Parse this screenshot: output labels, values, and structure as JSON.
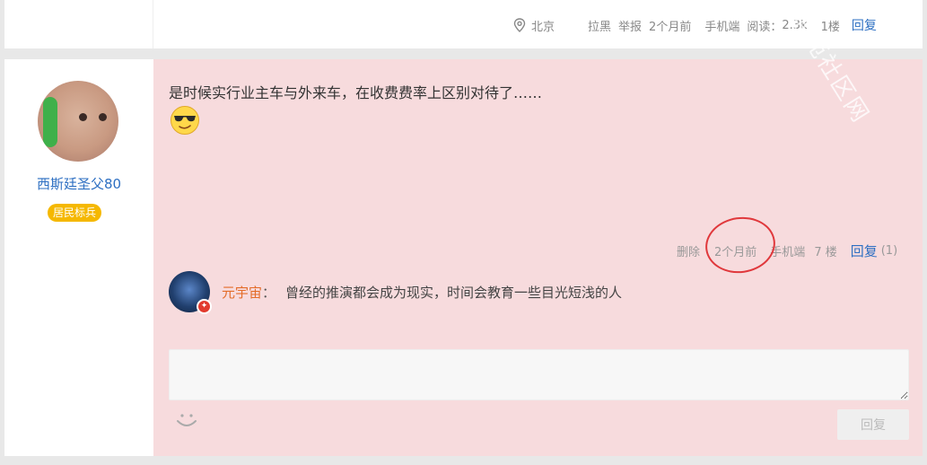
{
  "top_post": {
    "location": "北京",
    "actions": [
      "拉黑",
      "举报"
    ],
    "time": "2个月前",
    "device": "手机端",
    "reads_label": "阅读：",
    "reads_value": "2.3k",
    "floor": "1楼",
    "reply_label": "回复"
  },
  "post": {
    "author_name": "西斯廷圣父80",
    "author_rank": "居民标兵",
    "content": "是时候实行业主车与外来车，在收费费率上区别对待了……",
    "meta": {
      "delete_label": "删除",
      "time": "2个月前",
      "device": "手机端",
      "floor": "7 楼",
      "reply_label": "回复",
      "reply_count": "(1)"
    },
    "reply": {
      "name": "元宇宙",
      "colon": "：",
      "text": "曾经的推演都会成为现实，时间会教育一些目光短浅的人"
    },
    "submit_label": "回复",
    "reply_box_placeholder": ""
  },
  "watermark": "通苑社区网",
  "colors": {
    "accent_blue": "#2d6fc2",
    "post_bg": "#f7dbdd",
    "rank_badge": "#f5b800",
    "highlight_circle": "#e0383c"
  },
  "icons": [
    "location-pin-icon",
    "cool-emoji-icon",
    "smile-icon",
    "badge-icon"
  ]
}
